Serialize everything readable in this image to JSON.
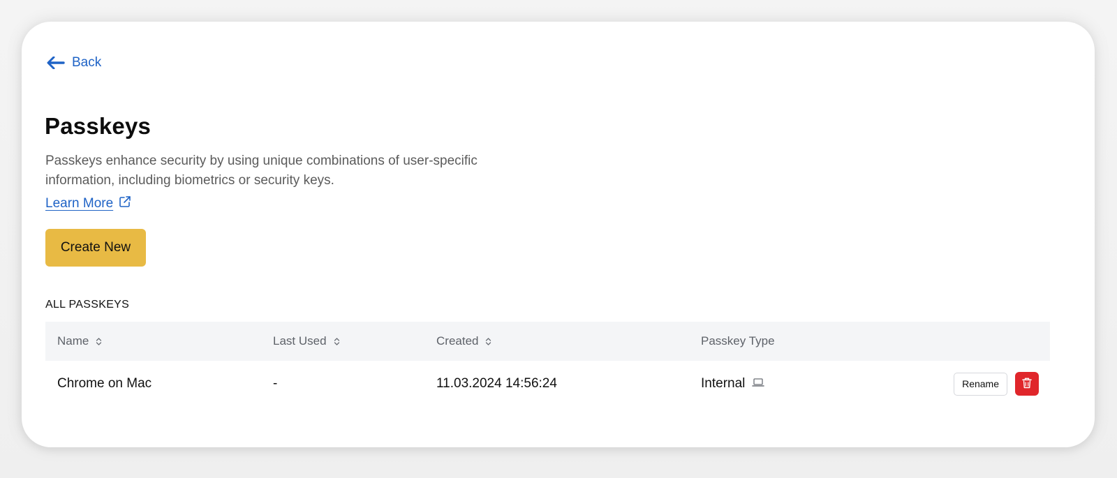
{
  "nav": {
    "back_label": "Back"
  },
  "page": {
    "title": "Passkeys",
    "description": "Passkeys enhance security by using unique combinations of user-specific information, including biometrics or security keys.",
    "learn_more_label": "Learn More",
    "create_button_label": "Create New",
    "section_label": "ALL PASSKEYS"
  },
  "table": {
    "columns": [
      "Name",
      "Last Used",
      "Created",
      "Passkey Type"
    ],
    "rows": [
      {
        "name": "Chrome on Mac",
        "last_used": "-",
        "created": "11.03.2024 14:56:24",
        "type": "Internal",
        "type_icon": "laptop-icon",
        "rename_label": "Rename",
        "delete_icon": "trash-icon"
      }
    ]
  },
  "colors": {
    "accent_link": "#1f63c6",
    "primary_button": "#e8ba44",
    "danger_button": "#e0262b",
    "table_header_bg": "#f4f5f7"
  },
  "icons": {
    "back": "arrow-left-icon",
    "learn_more": "external-link-icon",
    "sort": "sort-icon"
  }
}
